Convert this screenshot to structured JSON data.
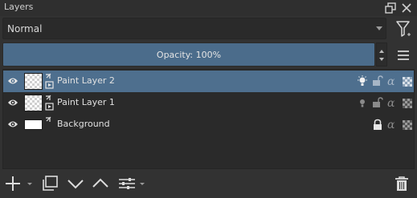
{
  "title": "Layers",
  "icons": {
    "float": "float-dock-icon",
    "close": "close-icon",
    "filter": "filter-icon",
    "menu": "hamburger-menu-icon"
  },
  "blend_mode": {
    "value": "Normal"
  },
  "opacity": {
    "label": "Opacity:",
    "value": "100%"
  },
  "layers": [
    {
      "name": "Paint Layer 2",
      "selected": true,
      "thumbnail": "transparent-checker",
      "type": "paint-layer"
    },
    {
      "name": "Paint Layer 1",
      "selected": false,
      "thumbnail": "transparent-checker",
      "type": "paint-layer"
    },
    {
      "name": "Background",
      "selected": false,
      "thumbnail": "white",
      "type": "paint-layer",
      "locked": true
    }
  ],
  "toolbar": {
    "add": "add-layer-icon",
    "duplicate": "duplicate-layer-icon",
    "move_down": "move-layer-down-icon",
    "move_up": "move-layer-up-icon",
    "properties": "layer-properties-icon",
    "delete": "delete-layer-icon"
  },
  "colors": {
    "panel_bg": "#323232",
    "list_bg": "#2a2a2a",
    "selection": "#4e6f8e",
    "opacity_fill": "#4b6c8b",
    "text": "#e0e0e0"
  }
}
